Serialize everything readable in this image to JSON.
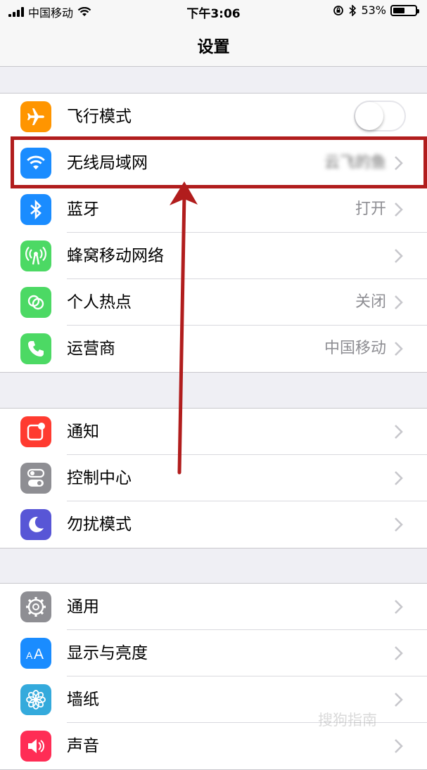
{
  "status_bar": {
    "carrier": "中国移动",
    "time": "下午3:06",
    "battery_percent": "53%",
    "battery_level": 0.53
  },
  "nav": {
    "title": "设置"
  },
  "groups": [
    {
      "items": [
        {
          "label": "飞行模式",
          "icon": "airplane-icon",
          "icon_color": "#ff9500",
          "toggle": false
        },
        {
          "label": "无线局域网",
          "icon": "wifi-icon",
          "icon_color": "#1a8cff",
          "value": "云飞的鱼"
        },
        {
          "label": "蓝牙",
          "icon": "bluetooth-icon",
          "icon_color": "#1a8cff",
          "value": "打开"
        },
        {
          "label": "蜂窝移动网络",
          "icon": "antenna-icon",
          "icon_color": "#4cd964"
        },
        {
          "label": "个人热点",
          "icon": "hotspot-icon",
          "icon_color": "#4cd964",
          "value": "关闭"
        },
        {
          "label": "运营商",
          "icon": "phone-icon",
          "icon_color": "#4cd964",
          "value": "中国移动"
        }
      ]
    },
    {
      "items": [
        {
          "label": "通知",
          "icon": "notification-icon",
          "icon_color": "#ff3b30"
        },
        {
          "label": "控制中心",
          "icon": "control-center-icon",
          "icon_color": "#8e8e93"
        },
        {
          "label": "勿扰模式",
          "icon": "moon-icon",
          "icon_color": "#5856d6"
        }
      ]
    },
    {
      "items": [
        {
          "label": "通用",
          "icon": "gear-icon",
          "icon_color": "#8e8e93"
        },
        {
          "label": "显示与亮度",
          "icon": "text-size-icon",
          "icon_color": "#1a8cff"
        },
        {
          "label": "墙纸",
          "icon": "flower-icon",
          "icon_color": "#34aadc"
        },
        {
          "label": "声音",
          "icon": "speaker-icon",
          "icon_color": "#ff2d55"
        }
      ]
    }
  ],
  "annotation": {
    "highlight_color": "#b11d1d"
  },
  "watermark": "搜狗指南"
}
